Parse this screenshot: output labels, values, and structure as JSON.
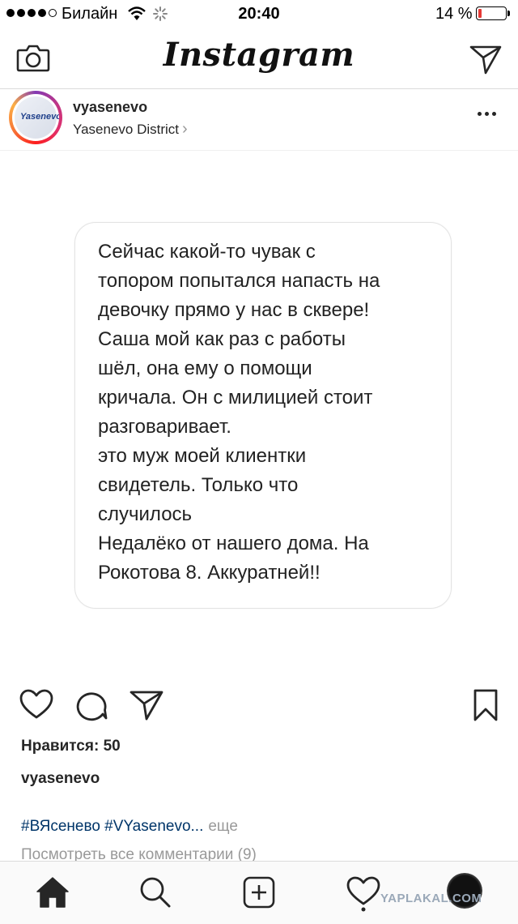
{
  "status_bar": {
    "carrier": "Билайн",
    "time": "20:40",
    "battery": "14 %",
    "battery_level": 0.14,
    "battery_color": "#e53935"
  },
  "header": {
    "app_name": "Instagram",
    "left_icon": "camera-icon",
    "right_icon": "direct-icon"
  },
  "post": {
    "username": "vyasenevo",
    "location": "Yasenevo District",
    "avatar_text": "Yasenevo",
    "message_lines": [
      "Сейчас какой-то чувак с",
      "топором попытался напасть на",
      "девочку прямо у нас в сквере!",
      "Саша мой как раз с работы",
      "шёл, она ему о помощи",
      "кричала. Он с милицией стоит",
      "разговаривает.",
      "это муж моей клиентки",
      "свидетель. Только что",
      "случилось",
      "Недалёко от нашего дома. На",
      "Рокотова 8. Аккуратней!!"
    ],
    "likes": "Нравится: 50",
    "caption_user": "vyasenevo",
    "hashtags": "#ВЯсенево #VYasenevo...",
    "more_label": "еще",
    "view_comments": "Посмотреть все комментарии (9)"
  },
  "tab_bar": {
    "items": [
      "home-icon",
      "search-icon",
      "add-icon",
      "activity-icon",
      "profile-avatar"
    ]
  },
  "watermark": "YAPLAKAL.COM"
}
